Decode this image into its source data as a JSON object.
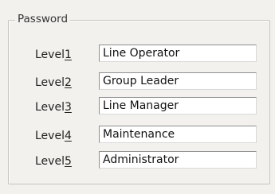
{
  "group": {
    "title": "Password"
  },
  "levels": [
    {
      "label_prefix": "Level",
      "label_key": "1",
      "value": "Line Operator"
    },
    {
      "label_prefix": "Level",
      "label_key": "2",
      "value": "Group Leader"
    },
    {
      "label_prefix": "Level",
      "label_key": "3",
      "value": "Line Manager"
    },
    {
      "label_prefix": "Level",
      "label_key": "4",
      "value": "Maintenance"
    },
    {
      "label_prefix": "Level",
      "label_key": "5",
      "value": "Administrator"
    }
  ]
}
